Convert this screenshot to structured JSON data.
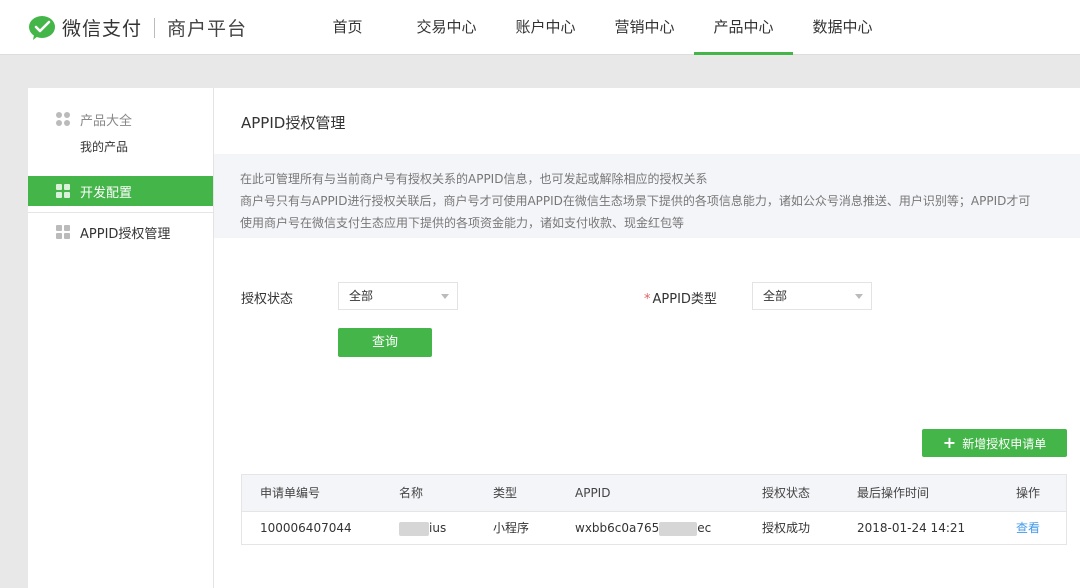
{
  "brand": {
    "name": "微信支付",
    "platform": "商户平台",
    "accent": "#44b549"
  },
  "nav": [
    "首页",
    "交易中心",
    "账户中心",
    "营销中心",
    "产品中心",
    "数据中心"
  ],
  "nav_active": "产品中心",
  "sidebar": {
    "group_title": "产品大全",
    "group_item": "我的产品",
    "active_item": "开发配置",
    "item": "APPID授权管理"
  },
  "page": {
    "title": "APPID授权管理",
    "notice_line1": "在此可管理所有与当前商户号有授权关系的APPID信息，也可发起或解除相应的授权关系",
    "notice_line2": "商户号只有与APPID进行授权关联后，商户号才可使用APPID在微信生态场景下提供的各项信息能力，诸如公众号消息推送、用户识别等；APPID才可",
    "notice_line3": "使用商户号在微信支付生态应用下提供的各项资金能力，诸如支付收款、现金红包等"
  },
  "filters": {
    "status_label": "授权状态",
    "status_value": "全部",
    "type_required": "*",
    "type_label": "APPID类型",
    "type_value": "全部",
    "query_button": "查询"
  },
  "new_button": "新增授权申请单",
  "table": {
    "headers": [
      "申请单编号",
      "名称",
      "类型",
      "APPID",
      "授权状态",
      "最后操作时间",
      "操作"
    ],
    "rows": [
      {
        "id": "100006407044",
        "name_suffix": "ius",
        "type": "小程序",
        "appid_prefix": "wxbb6c0a765",
        "appid_suffix": "ec",
        "status": "授权成功",
        "time": "2018-01-24 14:21",
        "action": "查看"
      }
    ]
  }
}
